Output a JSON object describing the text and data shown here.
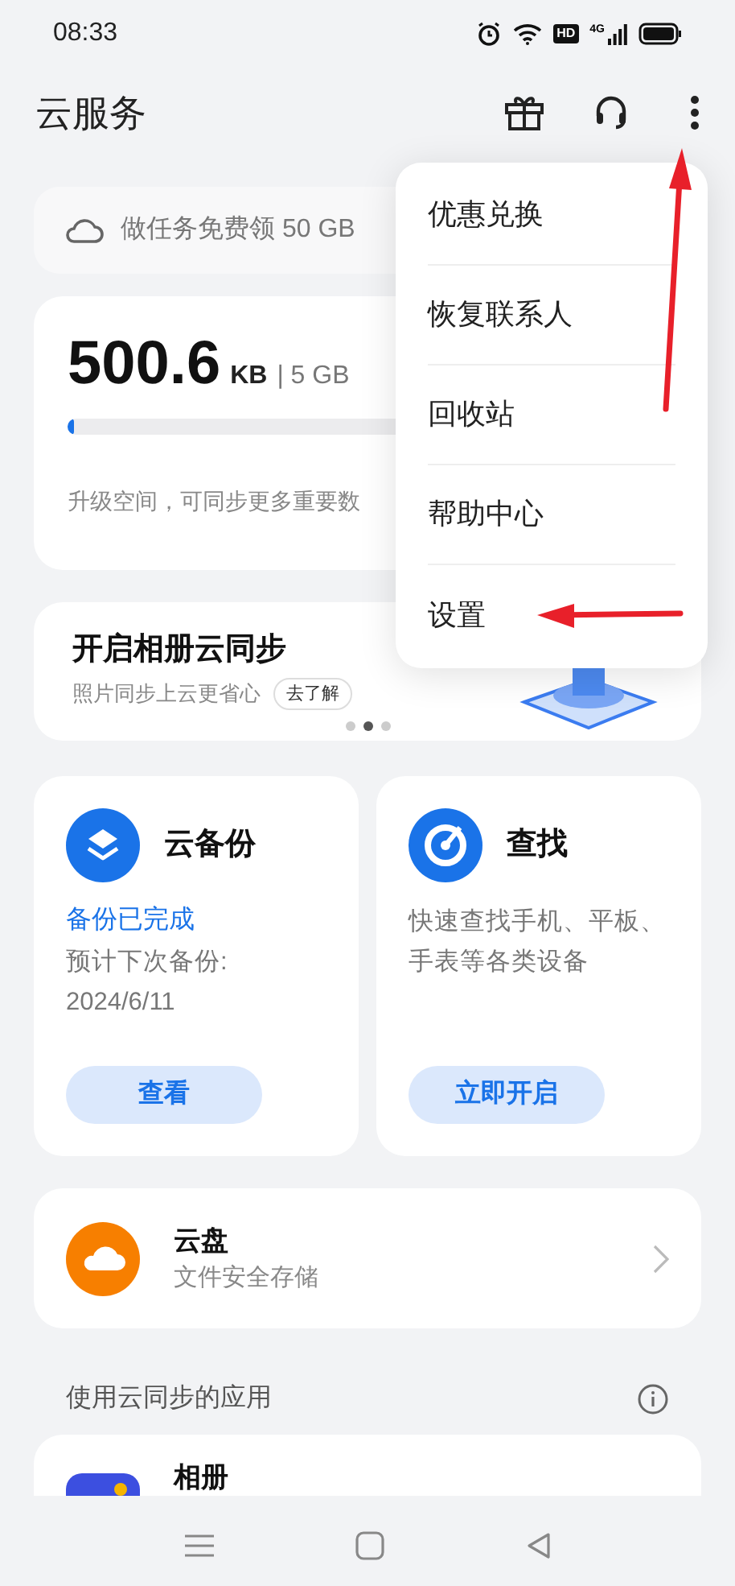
{
  "status_bar": {
    "time": "08:33",
    "hd_badge": "HD",
    "network": "4G"
  },
  "header": {
    "title": "云服务"
  },
  "promo": {
    "text": "做任务免费领 50 GB"
  },
  "storage": {
    "used": "500.6",
    "unit": "KB",
    "total": "| 5 GB",
    "level": 0.01,
    "hint": "升级空间，可同步更多重要数"
  },
  "album_banner": {
    "title": "开启相册云同步",
    "subtitle": "照片同步上云更省心",
    "link": "去了解",
    "dots": [
      {
        "selected": false
      },
      {
        "selected": true
      },
      {
        "selected": false
      }
    ]
  },
  "feature_cards": [
    {
      "kind": "backup",
      "title": "云备份",
      "status": "备份已完成",
      "description": "预计下次备份:\n2024/6/11",
      "button": "查看"
    },
    {
      "kind": "find",
      "title": "查找",
      "description": "快速查找手机、平板、手表等各类设备",
      "button": "立即开启"
    }
  ],
  "cloud_disk": {
    "title": "云盘",
    "subtitle": "文件安全存储"
  },
  "apps_section": {
    "title": "使用云同步的应用",
    "apps": [
      {
        "name": "相册"
      }
    ]
  },
  "menu": {
    "items": [
      "优惠兑换",
      "恢复联系人",
      "回收站",
      "帮助中心",
      "设置"
    ]
  }
}
